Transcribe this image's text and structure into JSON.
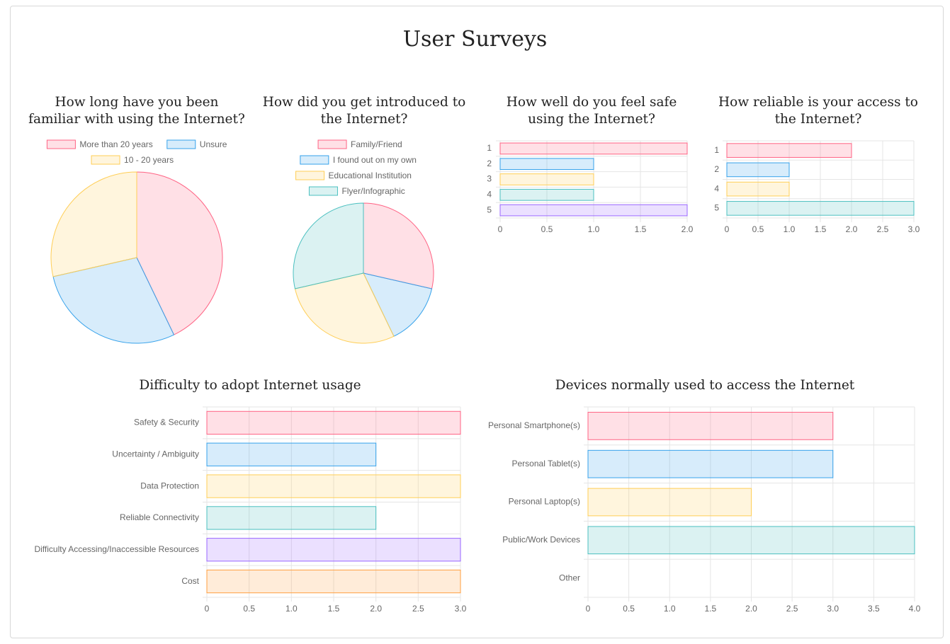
{
  "page": {
    "title": "User Surveys"
  },
  "colors": {
    "fills": [
      "rgba(255,99,132,0.2)",
      "rgba(54,162,235,0.2)",
      "rgba(255,206,86,0.2)",
      "rgba(75,192,192,0.2)",
      "rgba(153,102,255,0.2)",
      "rgba(255,159,64,0.2)"
    ],
    "borders": [
      "#ff6384",
      "#36a2eb",
      "#ffce56",
      "#4bc0c0",
      "#9966ff",
      "#ff9f40"
    ],
    "grid": "#e5e5e5",
    "tick_text": "#666666"
  },
  "chart_data": [
    {
      "id": "familiar",
      "type": "pie",
      "title": "How long have you been familiar with using the Internet?",
      "labels": [
        "More than 20 years",
        "Unsure",
        "10 - 20 years"
      ],
      "values": [
        3,
        2,
        2
      ]
    },
    {
      "id": "introduced",
      "type": "pie",
      "title": "How did you get introduced to the Internet?",
      "labels": [
        "Family/Friend",
        "I found out on my own",
        "Educational Institution",
        "Flyer/Infographic"
      ],
      "values": [
        2,
        1,
        2,
        2
      ]
    },
    {
      "id": "safe",
      "type": "bar",
      "orientation": "horizontal",
      "title": "How well do you feel safe using the Internet?",
      "categories": [
        "1",
        "2",
        "3",
        "4",
        "5"
      ],
      "values": [
        2,
        1,
        1,
        1,
        2
      ],
      "xlim": [
        0,
        2
      ],
      "ticks": [
        "0",
        "0.5",
        "1.0",
        "1.5",
        "2.0"
      ]
    },
    {
      "id": "reliable",
      "type": "bar",
      "orientation": "horizontal",
      "title": "How reliable is your access to the Internet?",
      "categories": [
        "1",
        "2",
        "4",
        "5"
      ],
      "values": [
        2,
        1,
        1,
        3
      ],
      "xlim": [
        0,
        3
      ],
      "ticks": [
        "0",
        "0.5",
        "1.0",
        "1.5",
        "2.0",
        "2.5",
        "3.0"
      ]
    },
    {
      "id": "difficulty",
      "type": "bar",
      "orientation": "horizontal",
      "title": "Difficulty to adopt Internet usage",
      "categories": [
        "Safety & Security",
        "Uncertainty / Ambiguity",
        "Data Protection",
        "Reliable Connectivity",
        "Difficulty Accessing/Inaccessible Resources",
        "Cost"
      ],
      "values": [
        3,
        2,
        3,
        2,
        3,
        3
      ],
      "xlim": [
        0,
        3
      ],
      "ticks": [
        "0",
        "0.5",
        "1.0",
        "1.5",
        "2.0",
        "2.5",
        "3.0"
      ]
    },
    {
      "id": "devices",
      "type": "bar",
      "orientation": "horizontal",
      "title": "Devices normally used to access the Internet",
      "categories": [
        "Personal Smartphone(s)",
        "Personal Tablet(s)",
        "Personal Laptop(s)",
        "Public/Work Devices",
        "Other"
      ],
      "values": [
        3,
        3,
        2,
        4,
        0
      ],
      "xlim": [
        0,
        4
      ],
      "ticks": [
        "0",
        "0.5",
        "1.0",
        "1.5",
        "2.0",
        "2.5",
        "3.0",
        "3.5",
        "4.0"
      ]
    }
  ]
}
